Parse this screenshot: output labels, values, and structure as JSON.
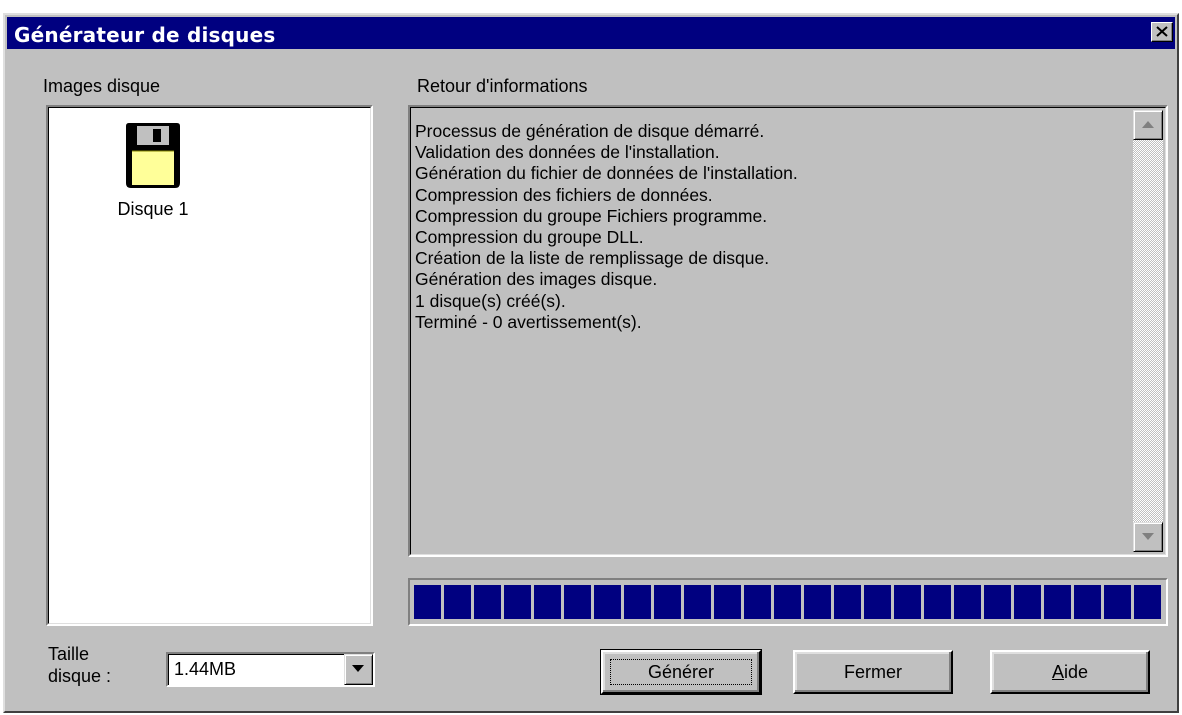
{
  "window": {
    "title": "Générateur de disques"
  },
  "images_panel": {
    "label": "Images disque",
    "items": [
      {
        "label": "Disque 1",
        "icon": "floppy-disk-icon"
      }
    ]
  },
  "feedback_panel": {
    "label": "Retour d'informations",
    "lines": [
      "Processus de génération de disque démarré.",
      "Validation des données de l'installation.",
      "Génération du fichier de données de l'installation.",
      "Compression des fichiers de données.",
      "Compression du groupe Fichiers programme.",
      "Compression du groupe DLL.",
      "Création de la liste de remplissage de disque.",
      "Génération des images disque.",
      "1 disque(s) créé(s).",
      "Terminé - 0 avertissement(s)."
    ]
  },
  "progress": {
    "percent": 100
  },
  "disk_size": {
    "label_line1": "Taille",
    "label_line2": "disque :",
    "value": "1.44MB"
  },
  "buttons": {
    "generate": "Générer",
    "close": "Fermer",
    "help_mnemonic": "A",
    "help_rest": "ide"
  },
  "colors": {
    "titlebar": "#000080",
    "face": "#c0c0c0",
    "progress": "#000080",
    "floppy_label": "#ffff99"
  }
}
